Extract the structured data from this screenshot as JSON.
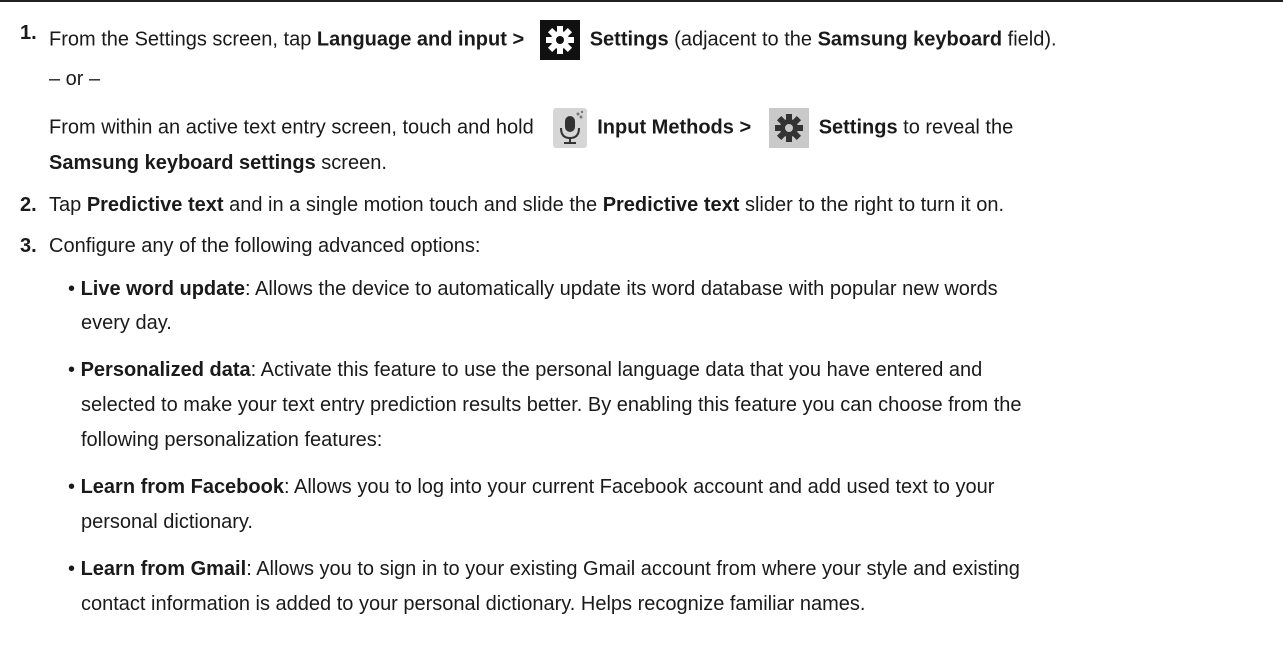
{
  "steps": [
    {
      "number": "1.",
      "line1": {
        "a": "From the Settings screen, tap ",
        "b1": "Language and input > ",
        "b2": "Settings",
        "c": " (adjacent to the ",
        "b3": "Samsung keyboard",
        "d": " field)."
      },
      "or": "– or –",
      "line2": {
        "a": "From within an active text entry screen, touch and hold ",
        "b1": "Input Methods > ",
        "b2": "Settings",
        "c": " to reveal the"
      },
      "line3": {
        "b1": "Samsung keyboard settings",
        "a": " screen."
      }
    },
    {
      "number": "2.",
      "a": "Tap ",
      "b1": "Predictive text",
      "c": " and in a single motion touch and slide the ",
      "b2": "Predictive text",
      "d": " slider to the right to turn it on."
    },
    {
      "number": "3.",
      "text": "Configure any of the following advanced options:"
    }
  ],
  "bullets": [
    {
      "term": "Live word update",
      "line1": ": Allows the device to automatically update its word database with popular new words",
      "line2": "every day."
    },
    {
      "term": "Personalized data",
      "line1": ": Activate this feature to use the personal language data that you have entered and",
      "line2": "selected to make your text entry prediction results better. By enabling this feature you can choose from the",
      "line3": "following personalization features:"
    },
    {
      "term": "Learn from Facebook",
      "line1": ": Allows you to log into your current Facebook account and add used text to your",
      "line2": "personal dictionary."
    },
    {
      "term": "Learn from Gmail",
      "line1": ": Allows you to sign in to your existing Gmail account from where your style and existing",
      "line2": "contact information is added to your personal dictionary. Helps recognize familiar names."
    }
  ],
  "bullet_char": "•",
  "icons": [
    "settings-gear-icon",
    "microphone-input-icon",
    "settings-gear-icon"
  ]
}
